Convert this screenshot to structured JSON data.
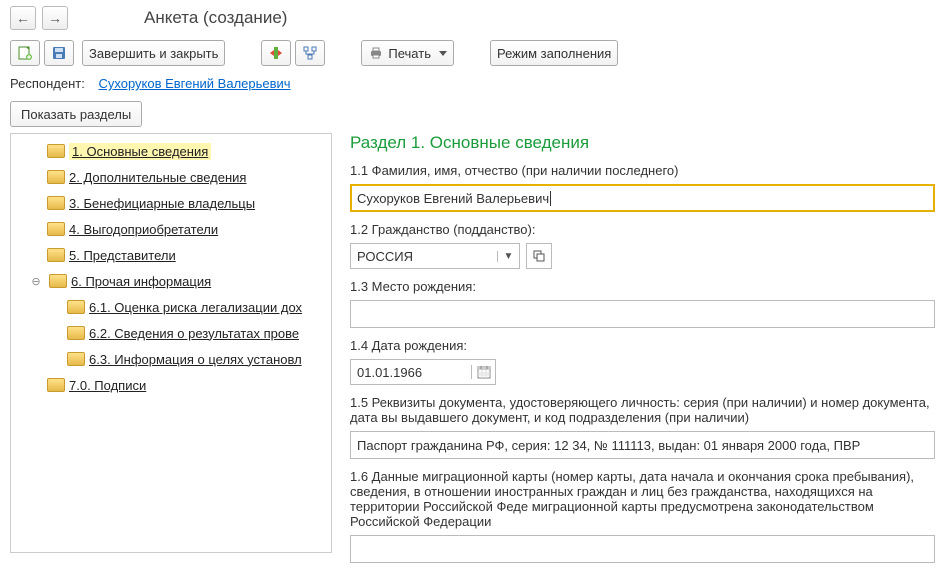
{
  "header": {
    "title": "Анкета (создание)"
  },
  "toolbar": {
    "finish_close": "Завершить и закрыть",
    "print": "Печать",
    "fill_mode": "Режим заполнения"
  },
  "respondent": {
    "label": "Респондент:",
    "name": "Сухоруков Евгений Валерьевич"
  },
  "show_sections": "Показать разделы",
  "tree": {
    "items": [
      {
        "label": "1. Основные сведения",
        "level": 0,
        "active": true
      },
      {
        "label": "2. Дополнительные сведения",
        "level": 0
      },
      {
        "label": "3. Бенефициарные владельцы",
        "level": 0
      },
      {
        "label": "4. Выгодоприобретатели",
        "level": 0
      },
      {
        "label": "5. Представители",
        "level": 0
      },
      {
        "label": "6. Прочая информация",
        "level": 0,
        "expanded": true
      },
      {
        "label": "6.1. Оценка риска легализации дох",
        "level": 1
      },
      {
        "label": "6.2. Сведения о результатах прове",
        "level": 1
      },
      {
        "label": "6.3. Информация о целях установл",
        "level": 1
      },
      {
        "label": "7.0. Подписи",
        "level": 0
      }
    ]
  },
  "form": {
    "title": "Раздел 1. Основные сведения",
    "f11_label": "1.1 Фамилия, имя, отчество (при наличии последнего)",
    "f11_value": "Сухоруков Евгений Валерьевич",
    "f12_label": "1.2 Гражданство (подданство):",
    "f12_value": "РОССИЯ",
    "f13_label": "1.3 Место рождения:",
    "f13_value": "",
    "f14_label": "1.4 Дата рождения:",
    "f14_value": "01.01.1966",
    "f15_label": "1.5 Реквизиты документа, удостоверяющего личность: серия (при наличии) и номер документа, дата вы выдавшего документ, и код подразделения (при наличии)",
    "f15_value": "Паспорт гражданина РФ, серия: 12 34, № 111113, выдан: 01 января 2000 года, ПВР",
    "f16_label": "1.6 Данные миграционной карты (номер карты, дата начала и окончания срока пребывания), сведения, в отношении иностранных граждан и лиц без гражданства, находящихся на территории Российской Феде миграционной карты предусмотрена законодательством Российской Федерации",
    "f16_value": ""
  }
}
